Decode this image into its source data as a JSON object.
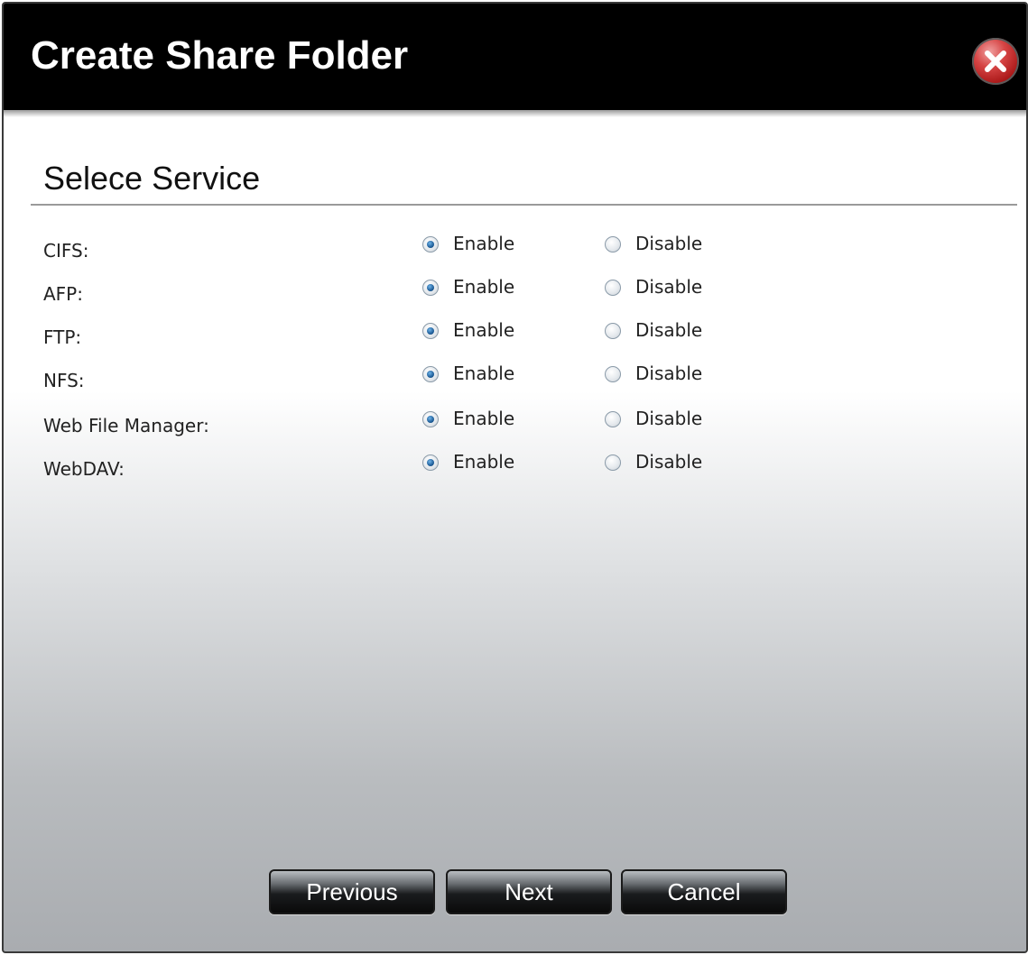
{
  "dialog": {
    "title": "Create Share Folder",
    "close_icon": "close-icon"
  },
  "section": {
    "title": "Selece Service"
  },
  "services": [
    {
      "label": "CIFS:",
      "enable_label": "Enable",
      "disable_label": "Disable",
      "selected": "Enable"
    },
    {
      "label": "AFP:",
      "enable_label": "Enable",
      "disable_label": "Disable",
      "selected": "Enable"
    },
    {
      "label": "FTP:",
      "enable_label": "Enable",
      "disable_label": "Disable",
      "selected": "Enable"
    },
    {
      "label": "NFS:",
      "enable_label": "Enable",
      "disable_label": "Disable",
      "selected": "Enable"
    },
    {
      "label": "Web File Manager:",
      "enable_label": "Enable",
      "disable_label": "Disable",
      "selected": "Enable"
    },
    {
      "label": "WebDAV:",
      "enable_label": "Enable",
      "disable_label": "Disable",
      "selected": "Enable"
    }
  ],
  "buttons": {
    "previous": "Previous",
    "next": "Next",
    "cancel": "Cancel"
  },
  "colors": {
    "titlebar": "#000000",
    "title_text": "#ffffff",
    "close_button": "#c62828",
    "radio_selected": "#1f5e99"
  }
}
